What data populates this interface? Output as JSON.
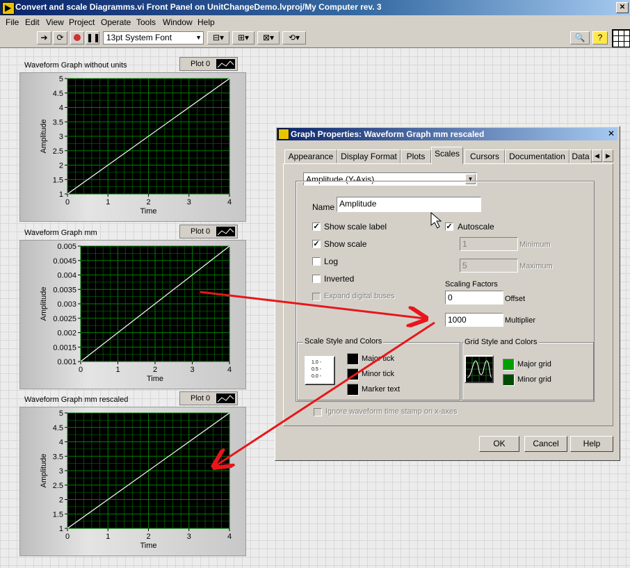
{
  "window": {
    "title": "Convert and scale Diagramms.vi Front Panel on UnitChangeDemo.lvproj/My Computer rev. 3"
  },
  "menu": [
    "File",
    "Edit",
    "View",
    "Project",
    "Operate",
    "Tools",
    "Window",
    "Help"
  ],
  "toolbar": {
    "font_select": "13pt System Font"
  },
  "graphs": [
    {
      "label": "Waveform Graph without units",
      "legend": "Plot 0",
      "xlabel": "Time",
      "ylabel": "Amplitude",
      "yticks": [
        "5",
        "4.5",
        "4",
        "3.5",
        "3",
        "2.5",
        "2",
        "1.5",
        "1"
      ],
      "xticks": [
        "0",
        "1",
        "2",
        "3",
        "4"
      ]
    },
    {
      "label": "Waveform Graph mm",
      "legend": "Plot 0",
      "xlabel": "Time",
      "ylabel": "Amplitude",
      "yticks": [
        "0.005",
        "0.0045",
        "0.004",
        "0.0035",
        "0.003",
        "0.0025",
        "0.002",
        "0.0015",
        "0.001"
      ],
      "xticks": [
        "0",
        "1",
        "2",
        "3",
        "4"
      ]
    },
    {
      "label": "Waveform Graph mm rescaled",
      "legend": "Plot 0",
      "xlabel": "Time",
      "ylabel": "Amplitude",
      "yticks": [
        "5",
        "4.5",
        "4",
        "3.5",
        "3",
        "2.5",
        "2",
        "1.5",
        "1"
      ],
      "xticks": [
        "0",
        "1",
        "2",
        "3",
        "4"
      ]
    }
  ],
  "dialog": {
    "title": "Graph Properties: Waveform Graph mm rescaled",
    "tabs": [
      "Appearance",
      "Display Format",
      "Plots",
      "Scales",
      "Cursors",
      "Documentation",
      "Data"
    ],
    "active_tab": "Scales",
    "axis_select": "Amplitude (Y-Axis)",
    "name_label": "Name",
    "name_value": "Amplitude",
    "show_scale_label": "Show scale label",
    "show_scale": "Show scale",
    "log": "Log",
    "inverted": "Inverted",
    "expand_digital": "Expand digital buses",
    "autoscale": "Autoscale",
    "minimum_value": "1",
    "minimum_label": "Minimum",
    "maximum_value": "5",
    "maximum_label": "Maximum",
    "scaling_factors": "Scaling Factors",
    "offset_value": "0",
    "offset_label": "Offset",
    "multiplier_value": "1000",
    "multiplier_label": "Multiplier",
    "scale_style_title": "Scale Style and Colors",
    "scale_style_icon": [
      "1.0 -",
      "0.5 -",
      "0.0 -"
    ],
    "major_tick": "Major tick",
    "minor_tick": "Minor tick",
    "marker_text": "Marker text",
    "grid_style_title": "Grid Style and Colors",
    "major_grid": "Major grid",
    "minor_grid": "Minor grid",
    "ignore_timestamp": "Ignore waveform time stamp on x-axes",
    "ok": "OK",
    "cancel": "Cancel",
    "help": "Help"
  },
  "colors": {
    "plot_bg": "#000000",
    "grid": "#008000",
    "trace": "#ffffff",
    "arrow": "#e8161b",
    "major_grid": "#00a000",
    "minor_grid": "#004d00"
  }
}
